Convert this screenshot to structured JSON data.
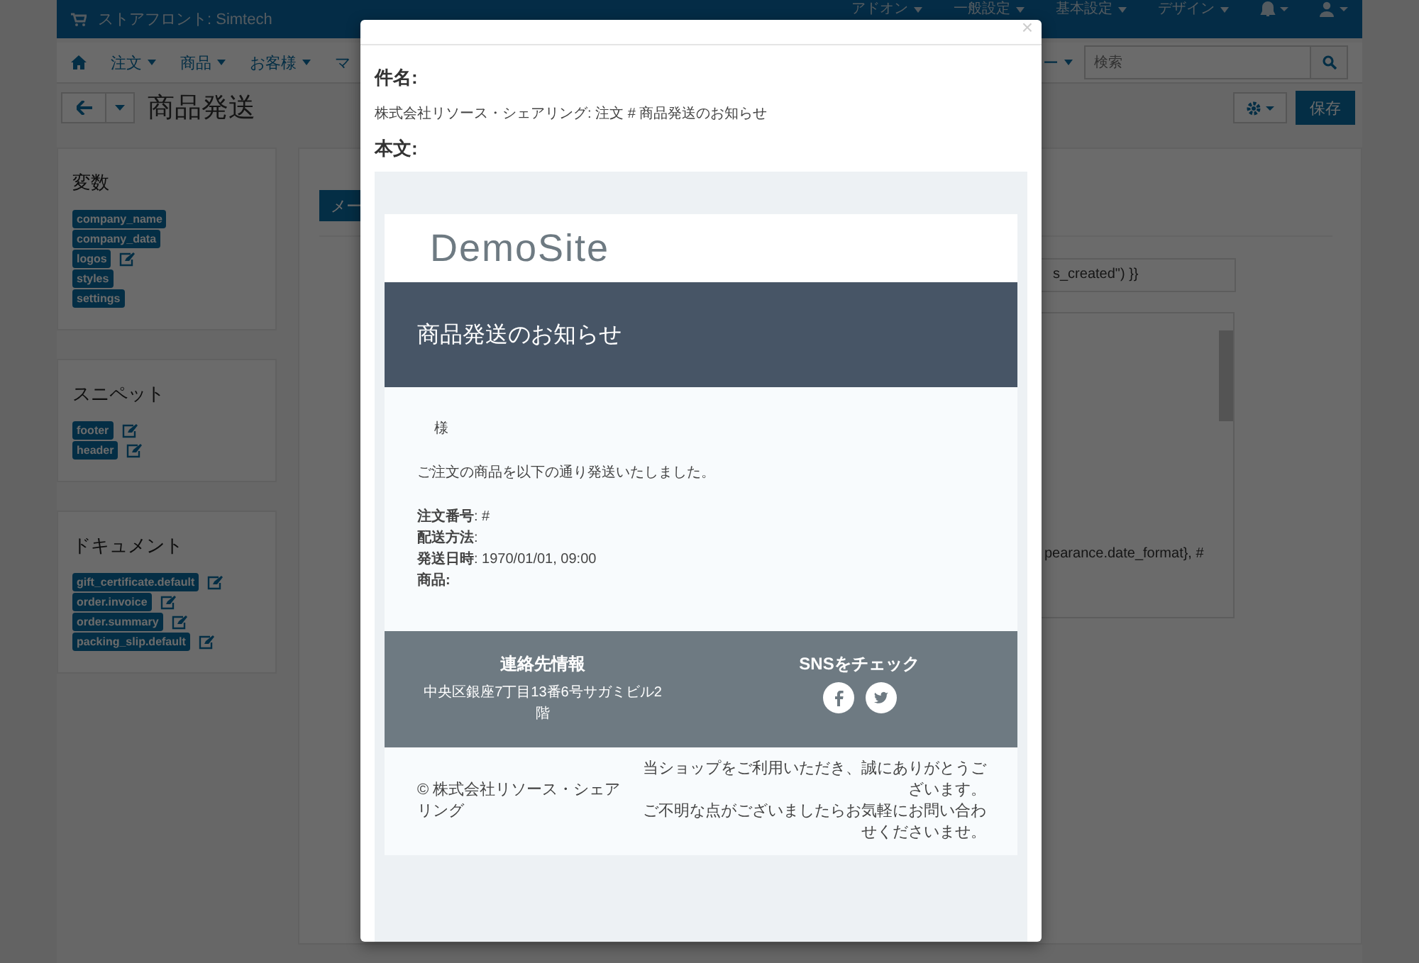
{
  "top_bar": {
    "store": "ストアフロント: Simtech",
    "menus": [
      "アドオン",
      "一般設定",
      "基本設定",
      "デザイン"
    ]
  },
  "nav": {
    "items": [
      "注文",
      "商品",
      "お客様",
      "マ"
    ],
    "cut_item": "ー",
    "search_placeholder": "検索"
  },
  "title_bar": {
    "title": "商品発送",
    "save": "保存"
  },
  "sidebar": [
    {
      "title": "変数",
      "items": [
        {
          "label": "company_name",
          "editable": false
        },
        {
          "label": "company_data",
          "editable": false
        },
        {
          "label": "logos",
          "editable": true
        },
        {
          "label": "styles",
          "editable": false
        },
        {
          "label": "settings",
          "editable": false
        }
      ]
    },
    {
      "title": "スニペット",
      "items": [
        {
          "label": "footer",
          "editable": true
        },
        {
          "label": "header",
          "editable": true
        }
      ]
    },
    {
      "title": "ドキュメント",
      "items": [
        {
          "label": "gift_certificate.default",
          "editable": true
        },
        {
          "label": "order.invoice",
          "editable": true
        },
        {
          "label": "order.summary",
          "editable": true
        },
        {
          "label": "packing_slip.default",
          "editable": true
        }
      ]
    }
  ],
  "main": {
    "button": "メー",
    "field_value": "s_created\") }}",
    "textarea_text": "pearance.date_format}, #"
  },
  "modal": {
    "close": "×",
    "subject_label": "件名:",
    "subject": "株式会社リソース・シェアリング: 注文 # 商品発送のお知らせ",
    "body_label": "本文:",
    "email": {
      "logo": "DemoSite",
      "heading": "商品発送のお知らせ",
      "salutation": "様",
      "intro": "ご注文の商品を以下の通り発送いたしました。",
      "details": [
        "**注文番号**: #",
        "**配送方法**:",
        "**発送日時**: 1970/01/01, 09:00",
        "**商品:**"
      ],
      "contact_title": "連絡先情報",
      "address": "中央区銀座7丁目13番6号サガミビル2階",
      "sns_title": "SNSをチェック",
      "copyright": "© 株式会社リソース・シェアリング",
      "thanks": [
        "当ショップをご利用いただき、誠にありがとうございます。",
        "ご不明な点がございましたらお気軽にお問い合わせくださいませ。"
      ]
    }
  }
}
